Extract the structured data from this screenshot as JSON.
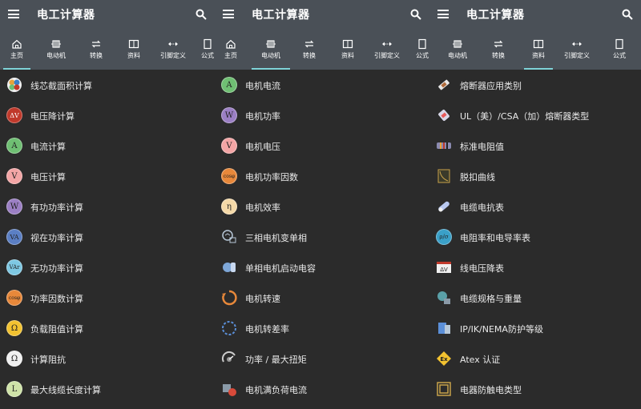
{
  "panels": [
    {
      "title": "电工计算器",
      "tabs": [
        {
          "label": "主页",
          "icon": "home-icon",
          "active": true
        },
        {
          "label": "电动机",
          "icon": "motor-icon",
          "active": false
        },
        {
          "label": "转换",
          "icon": "convert-icon",
          "active": false
        },
        {
          "label": "资料",
          "icon": "book-icon",
          "active": false
        },
        {
          "label": "引脚定义",
          "icon": "pinout-icon",
          "active": false
        },
        {
          "label": "公式",
          "icon": "formula-icon",
          "active": false
        }
      ],
      "items": [
        {
          "label": "线芯截面积计算",
          "icon": "wire-cross-section-icon",
          "glyph": "",
          "color": "#e8a33a"
        },
        {
          "label": "电压降计算",
          "icon": "voltage-drop-icon",
          "glyph": "ΔV",
          "color": "#c0392b"
        },
        {
          "label": "电流计算",
          "icon": "current-icon",
          "glyph": "A",
          "color": "#6fbf73"
        },
        {
          "label": "电压计算",
          "icon": "voltage-icon",
          "glyph": "V",
          "color": "#f3a5a5"
        },
        {
          "label": "有功功率计算",
          "icon": "active-power-icon",
          "glyph": "W",
          "color": "#9b7fc4"
        },
        {
          "label": "视在功率计算",
          "icon": "apparent-power-icon",
          "glyph": "VA",
          "color": "#5b7fc4"
        },
        {
          "label": "无功功率计算",
          "icon": "reactive-power-icon",
          "glyph": "VAr",
          "color": "#7ec8e3"
        },
        {
          "label": "功率因数计算",
          "icon": "power-factor-icon",
          "glyph": "cosφ",
          "color": "#e8883a"
        },
        {
          "label": "负载阻值计算",
          "icon": "load-resistance-icon",
          "glyph": "Ω",
          "color": "#f2c230"
        },
        {
          "label": "计算阻抗",
          "icon": "impedance-icon",
          "glyph": "Ω",
          "color": "#f0f0f0"
        },
        {
          "label": "最大线缆长度计算",
          "icon": "max-cable-length-icon",
          "glyph": "L",
          "color": "#cfe3a8"
        }
      ]
    },
    {
      "title": "电工计算器",
      "tabs": [
        {
          "label": "主页",
          "icon": "home-icon",
          "active": false
        },
        {
          "label": "电动机",
          "icon": "motor-icon",
          "active": true
        },
        {
          "label": "转换",
          "icon": "convert-icon",
          "active": false
        },
        {
          "label": "资料",
          "icon": "book-icon",
          "active": false
        },
        {
          "label": "引脚定义",
          "icon": "pinout-icon",
          "active": false
        },
        {
          "label": "公式",
          "icon": "formula-icon",
          "active": false
        }
      ],
      "items": [
        {
          "label": "电机电流",
          "icon": "motor-current-icon",
          "glyph": "A",
          "color": "#6fbf73"
        },
        {
          "label": "电机功率",
          "icon": "motor-power-icon",
          "glyph": "W",
          "color": "#9b7fc4"
        },
        {
          "label": "电机电压",
          "icon": "motor-voltage-icon",
          "glyph": "V",
          "color": "#f3a5a5"
        },
        {
          "label": "电机功率因数",
          "icon": "motor-power-factor-icon",
          "glyph": "cosφ",
          "color": "#e8883a"
        },
        {
          "label": "电机效率",
          "icon": "motor-efficiency-icon",
          "glyph": "η",
          "color": "#f5d9a8"
        },
        {
          "label": "三相电机变单相",
          "icon": "three-phase-to-single-icon",
          "glyph": "",
          "color": "#8aa0b8"
        },
        {
          "label": "单相电机启动电容",
          "icon": "start-capacitor-icon",
          "glyph": "",
          "color": "#7ea7d8"
        },
        {
          "label": "电机转速",
          "icon": "motor-speed-icon",
          "glyph": "",
          "color": "#e8883a"
        },
        {
          "label": "电机转差率",
          "icon": "motor-slip-icon",
          "glyph": "",
          "color": "#5b8fd8"
        },
        {
          "label": "功率 / 最大扭矩",
          "icon": "torque-icon",
          "glyph": "",
          "color": "#cccccc"
        },
        {
          "label": "电机满负荷电流",
          "icon": "full-load-current-icon",
          "glyph": "",
          "color": "#d84a3a"
        }
      ]
    },
    {
      "title": "电工计算器",
      "tabs": [
        {
          "label": "电动机",
          "icon": "motor-icon",
          "active": false
        },
        {
          "label": "转换",
          "icon": "convert-icon",
          "active": false
        },
        {
          "label": "资料",
          "icon": "book-icon",
          "active": true
        },
        {
          "label": "引脚定义",
          "icon": "pinout-icon",
          "active": false
        },
        {
          "label": "公式",
          "icon": "formula-icon",
          "active": false
        }
      ],
      "items": [
        {
          "label": "熔断器应用类别",
          "icon": "fuse-category-icon",
          "glyph": "",
          "color": "#e8e8e8"
        },
        {
          "label": "UL（美）/CSA（加）熔断器类型",
          "icon": "ul-csa-fuse-icon",
          "glyph": "",
          "color": "#e85a5a"
        },
        {
          "label": "标准电阻值",
          "icon": "resistor-values-icon",
          "glyph": "",
          "color": "#e8a33a"
        },
        {
          "label": "脱扣曲线",
          "icon": "trip-curve-icon",
          "glyph": "",
          "color": "#c8a24a"
        },
        {
          "label": "电缆电抗表",
          "icon": "cable-reactance-icon",
          "glyph": "",
          "color": "#b8c8f0"
        },
        {
          "label": "电阻率和电导率表",
          "icon": "resistivity-icon",
          "glyph": "ρ/σ",
          "color": "#3aa0c8"
        },
        {
          "label": "线电压降表",
          "icon": "line-voltage-drop-icon",
          "glyph": "ΔV",
          "color": "#c0392b"
        },
        {
          "label": "电缆规格与重量",
          "icon": "cable-weight-icon",
          "glyph": "",
          "color": "#5aa0a8"
        },
        {
          "label": "IP/IK/NEMA防护等级",
          "icon": "protection-rating-icon",
          "glyph": "",
          "color": "#5b8fd8"
        },
        {
          "label": "Atex 认证",
          "icon": "atex-icon",
          "glyph": "Ex",
          "color": "#f2c230"
        },
        {
          "label": "电器防触电类型",
          "icon": "shock-protection-icon",
          "glyph": "",
          "color": "#c8a24a"
        }
      ]
    }
  ]
}
